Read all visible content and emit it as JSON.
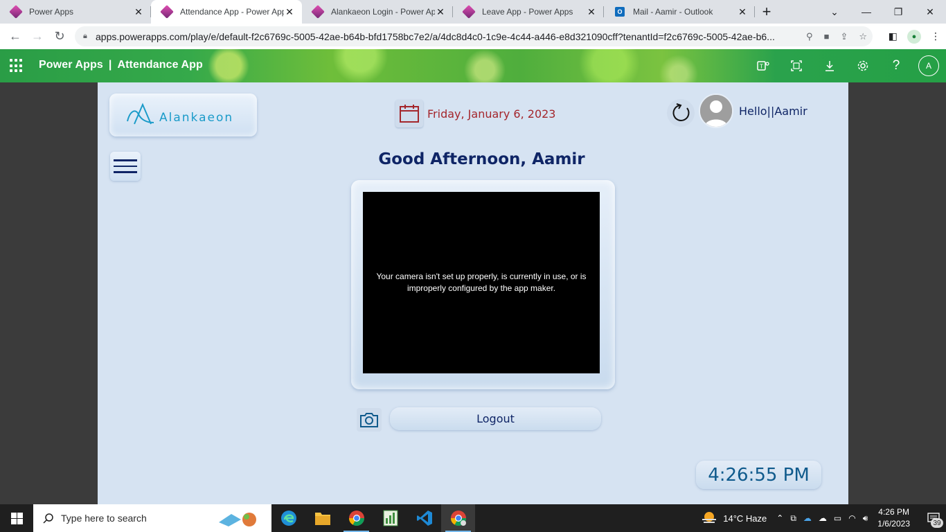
{
  "browser": {
    "tabs": [
      {
        "title": "Power Apps",
        "icon": "powerapps-icon"
      },
      {
        "title": "Attendance App - Power Apps",
        "icon": "powerapps-icon"
      },
      {
        "title": "Alankaeon Login - Power Apps",
        "icon": "powerapps-icon"
      },
      {
        "title": "Leave App - Power Apps",
        "icon": "powerapps-icon"
      },
      {
        "title": "Mail - Aamir - Outlook",
        "icon": "outlook-icon"
      }
    ],
    "url": "apps.powerapps.com/play/e/default-f2c6769c-5005-42ae-b64b-bfd1758bc7e2/a/4dc8d4c0-1c9e-4c44-a446-e8d321090cff?tenantId=f2c6769c-5005-42ae-b6...",
    "profile_initial": ""
  },
  "powerapps_header": {
    "product": "Power Apps",
    "separator": "|",
    "app_name": "Attendance App",
    "avatar_initial": "A"
  },
  "app": {
    "logo_text": "Alankaeon",
    "date": "Friday, January 6, 2023",
    "hello": "Hello||Aamir",
    "greeting": "Good Afternoon, Aamir",
    "camera_message": "Your camera isn't set up properly, is currently in use, or is improperly configured by the app maker.",
    "logout_label": "Logout",
    "clock": "4:26:55 PM",
    "colors": {
      "canvas_bg": "#d6e3f2",
      "navy": "#0f2566",
      "date_red": "#a4262c",
      "clock_blue": "#0f5a8c"
    }
  },
  "taskbar": {
    "search_placeholder": "Type here to search",
    "weather": "14°C  Haze",
    "time": "4:26 PM",
    "date": "1/6/2023",
    "notification_count": "39"
  }
}
